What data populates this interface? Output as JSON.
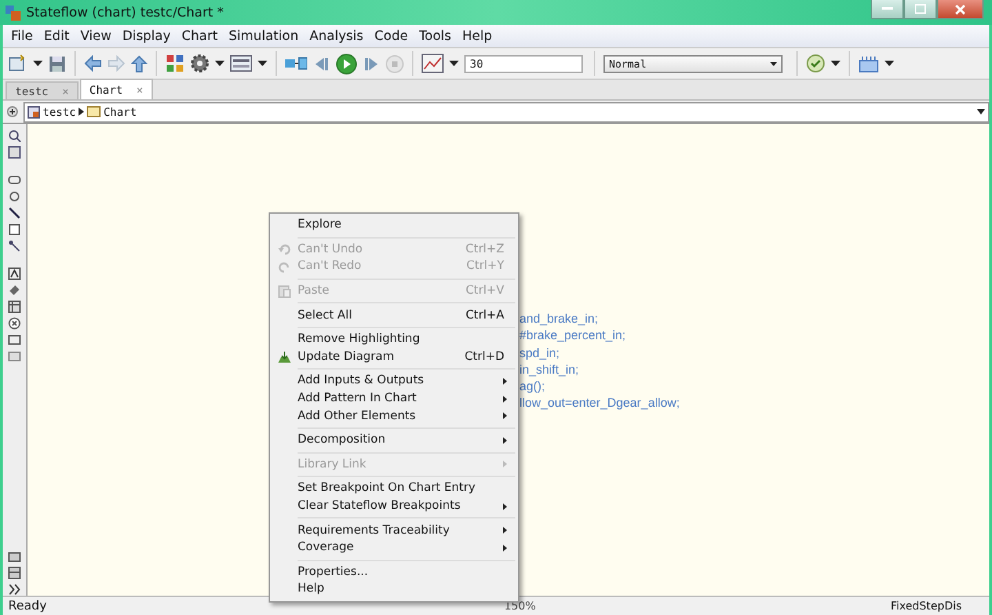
{
  "window": {
    "title": "Stateflow (chart) testc/Chart *"
  },
  "menu_bar": [
    "File",
    "Edit",
    "View",
    "Display",
    "Chart",
    "Simulation",
    "Analysis",
    "Code",
    "Tools",
    "Help"
  ],
  "toolbar": {
    "stop_time": "30",
    "sim_mode": "Normal"
  },
  "tabs": [
    {
      "label": "testc",
      "close": "×",
      "selected": false
    },
    {
      "label": "Chart",
      "close": "×",
      "selected": true
    }
  ],
  "breadcrumb": [
    "testc",
    "Chart"
  ],
  "code_lines": [
    "and_brake_in;",
    "#brake_percent_in;",
    "spd_in;",
    "in_shift_in;",
    "ag();",
    "llow_out=enter_Dgear_allow;"
  ],
  "context_menu": [
    [
      {
        "label": "Explore",
        "disabled": false,
        "submenu": false
      }
    ],
    [
      {
        "label": "Can't Undo",
        "shortcut": "Ctrl+Z",
        "kind": "undo",
        "disabled": true,
        "submenu": false
      },
      {
        "label": "Can't Redo",
        "shortcut": "Ctrl+Y",
        "kind": "redo",
        "disabled": true,
        "submenu": false
      }
    ],
    [
      {
        "label": "Paste",
        "shortcut": "Ctrl+V",
        "kind": "paste",
        "disabled": true,
        "submenu": false
      }
    ],
    [
      {
        "label": "Select All",
        "shortcut": "Ctrl+A",
        "disabled": false,
        "submenu": false
      }
    ],
    [
      {
        "label": "Remove Highlighting",
        "disabled": false,
        "submenu": false
      },
      {
        "label": "Update Diagram",
        "shortcut": "Ctrl+D",
        "kind": "update",
        "disabled": false,
        "submenu": false
      }
    ],
    [
      {
        "label": "Add Inputs & Outputs",
        "disabled": false,
        "submenu": true
      },
      {
        "label": "Add Pattern In Chart",
        "disabled": false,
        "submenu": true
      },
      {
        "label": "Add Other Elements",
        "disabled": false,
        "submenu": true
      }
    ],
    [
      {
        "label": "Decomposition",
        "disabled": false,
        "submenu": true
      }
    ],
    [
      {
        "label": "Library Link",
        "disabled": true,
        "submenu": true
      }
    ],
    [
      {
        "label": "Set Breakpoint On Chart Entry",
        "disabled": false,
        "submenu": false
      },
      {
        "label": "Clear Stateflow Breakpoints",
        "disabled": false,
        "submenu": true
      }
    ],
    [
      {
        "label": "Requirements Traceability",
        "disabled": false,
        "submenu": true
      },
      {
        "label": "Coverage",
        "disabled": false,
        "submenu": true
      }
    ],
    [
      {
        "label": "Properties...",
        "disabled": false,
        "submenu": false
      },
      {
        "label": "Help",
        "disabled": false,
        "submenu": false
      }
    ]
  ],
  "status_bar": {
    "left": "Ready",
    "zoom": "150%",
    "solver": "FixedStepDis"
  }
}
